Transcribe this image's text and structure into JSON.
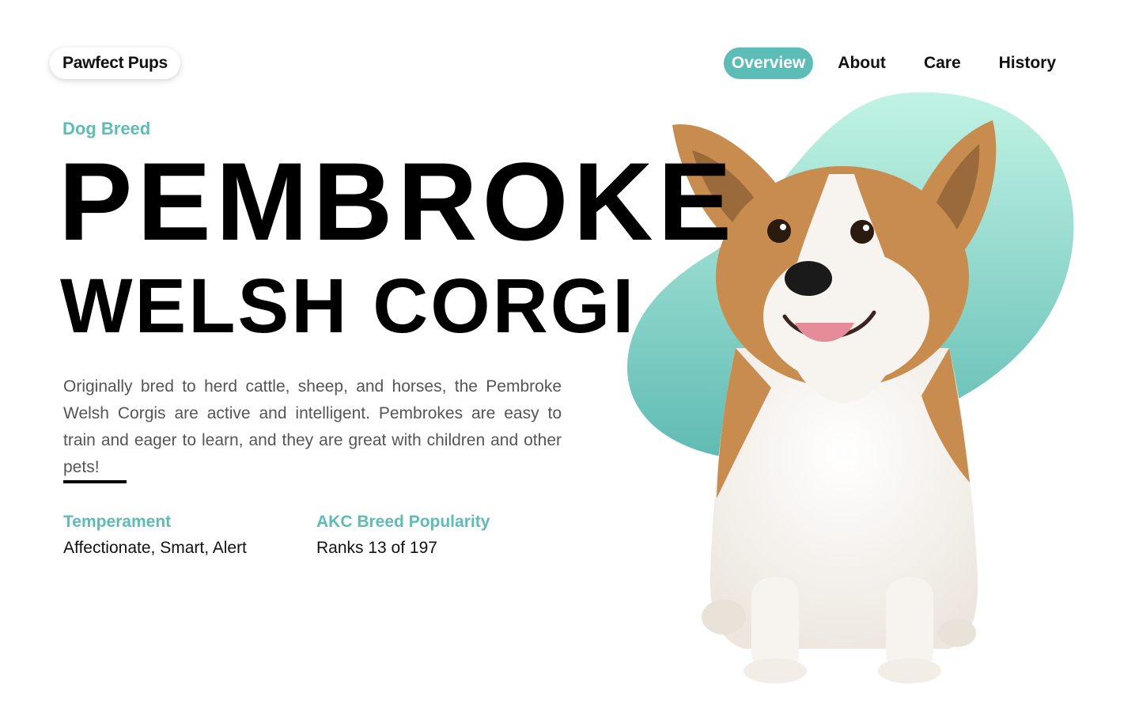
{
  "brand": {
    "name": "Pawfect Pups",
    "accent": "#5cbdb6",
    "blob_top": "#c1f3e4",
    "blob_bottom": "#5ebbb3",
    "fur_tan": "#c98c4f",
    "fur_white": "#f7f3ee"
  },
  "nav": {
    "items": [
      {
        "label": "Overview",
        "active": true
      },
      {
        "label": "About",
        "active": false
      },
      {
        "label": "Care",
        "active": false
      },
      {
        "label": "History",
        "active": false
      }
    ]
  },
  "hero": {
    "eyebrow": "Dog Breed",
    "title_line1": "PEMBROKE",
    "title_line2": "WELSH CORGI",
    "description": "Originally bred to herd cattle, sheep, and horses, the Pembroke Welsh Corgis are active and intelligent. Pembrokes are easy to train and eager to learn, and they are great with children and other pets!",
    "image_icon": "corgi-photo"
  },
  "stats": [
    {
      "label": "Temperament",
      "value": "Affectionate, Smart, Alert"
    },
    {
      "label": "AKC Breed Popularity",
      "value": "Ranks 13 of 197"
    }
  ]
}
